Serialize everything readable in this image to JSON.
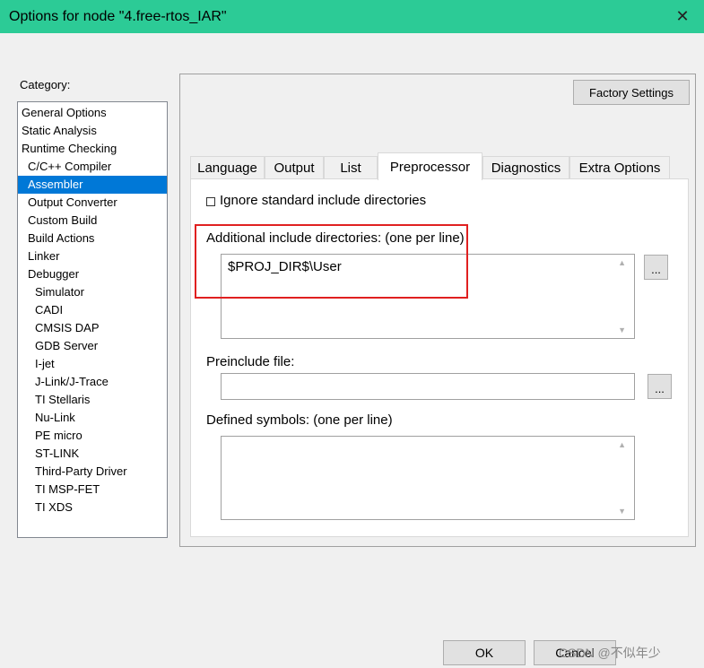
{
  "window": {
    "title": "Options for node \"4.free-rtos_IAR\"",
    "close_glyph": "✕"
  },
  "category": {
    "label": "Category:",
    "items": [
      {
        "label": "General Options",
        "level": 0
      },
      {
        "label": "Static Analysis",
        "level": 0
      },
      {
        "label": "Runtime Checking",
        "level": 0
      },
      {
        "label": "C/C++ Compiler",
        "level": 1
      },
      {
        "label": "Assembler",
        "level": 1,
        "selected": true
      },
      {
        "label": "Output Converter",
        "level": 1
      },
      {
        "label": "Custom Build",
        "level": 1
      },
      {
        "label": "Build Actions",
        "level": 1
      },
      {
        "label": "Linker",
        "level": 1
      },
      {
        "label": "Debugger",
        "level": 1
      },
      {
        "label": "Simulator",
        "level": 2
      },
      {
        "label": "CADI",
        "level": 2
      },
      {
        "label": "CMSIS DAP",
        "level": 2
      },
      {
        "label": "GDB Server",
        "level": 2
      },
      {
        "label": "I-jet",
        "level": 2
      },
      {
        "label": "J-Link/J-Trace",
        "level": 2
      },
      {
        "label": "TI Stellaris",
        "level": 2
      },
      {
        "label": "Nu-Link",
        "level": 2
      },
      {
        "label": "PE micro",
        "level": 2
      },
      {
        "label": "ST-LINK",
        "level": 2
      },
      {
        "label": "Third-Party Driver",
        "level": 2
      },
      {
        "label": "TI MSP-FET",
        "level": 2
      },
      {
        "label": "TI XDS",
        "level": 2
      }
    ]
  },
  "factory_settings_label": "Factory Settings",
  "tabs": [
    {
      "label": "Language"
    },
    {
      "label": "Output"
    },
    {
      "label": "List"
    },
    {
      "label": "Preprocessor",
      "active": true
    },
    {
      "label": "Diagnostics"
    },
    {
      "label": "Extra Options"
    }
  ],
  "preprocessor": {
    "ignore_std_label": "Ignore standard include directories",
    "ignore_std_checked": false,
    "include_dirs_label": "Additional include directories:  (one per line)",
    "include_dirs_value": "$PROJ_DIR$\\User",
    "preinclude_label": "Preinclude file:",
    "preinclude_value": "",
    "defined_symbols_label": "Defined symbols:  (one per line)",
    "defined_symbols_value": "",
    "browse_label": "...",
    "scroll_up_glyph": "▲",
    "scroll_down_glyph": "▼"
  },
  "buttons": {
    "ok": "OK",
    "cancel": "Cancel"
  },
  "watermark": "CSDN @不似年少",
  "colors": {
    "titlebar": "#2ccb96",
    "selection": "#0078d7",
    "highlight_box": "#e02020"
  }
}
